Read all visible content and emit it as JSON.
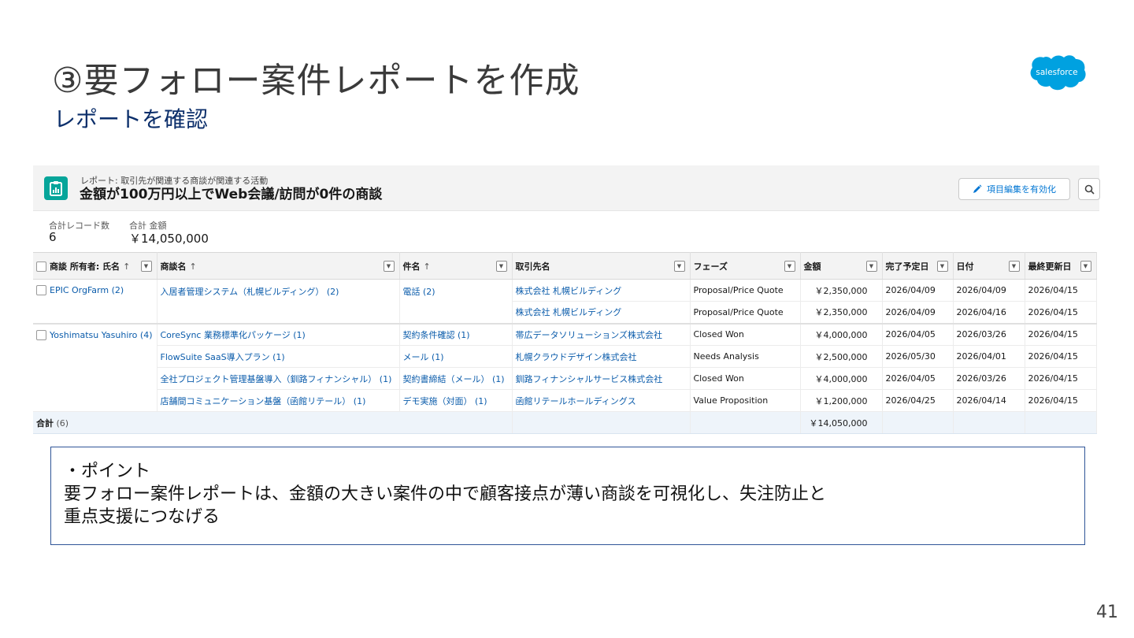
{
  "slide": {
    "title": "③要フォロー案件レポートを作成",
    "subtitle": "レポートを確認",
    "page_number": "41",
    "logo_text": "salesforce"
  },
  "report": {
    "type_label": "レポート: 取引先が関連する商談が関連する活動",
    "name": "金額が100万円以上でWeb会議/訪問が0件の商談",
    "enable_button": "項目編集を有効化",
    "summary": {
      "record_count_label": "合計レコード数",
      "record_count_value": "6",
      "total_amount_label": "合計 金額",
      "total_amount_value": "￥14,050,000"
    },
    "columns": [
      {
        "label": "商談 所有者: 氏名",
        "sort": "↑"
      },
      {
        "label": "商談名",
        "sort": "↑"
      },
      {
        "label": "件名",
        "sort": "↑"
      },
      {
        "label": "取引先名",
        "sort": ""
      },
      {
        "label": "フェーズ",
        "sort": ""
      },
      {
        "label": "金額",
        "sort": ""
      },
      {
        "label": "完了予定日",
        "sort": ""
      },
      {
        "label": "日付",
        "sort": ""
      },
      {
        "label": "最終更新日",
        "sort": ""
      }
    ],
    "rows": [
      [
        "EPIC OrgFarm (2)",
        "入居者管理システム（札幌ビルディング） (2)",
        "電話 (2)",
        "株式会社 札幌ビルディング",
        "Proposal/Price Quote",
        "￥2,350,000",
        "2026/04/09",
        "2026/04/09",
        "2026/04/15"
      ],
      [
        "",
        "",
        "",
        "株式会社 札幌ビルディング",
        "Proposal/Price Quote",
        "￥2,350,000",
        "2026/04/09",
        "2026/04/16",
        "2026/04/15"
      ],
      [
        "Yoshimatsu Yasuhiro (4)",
        "CoreSync 業務標準化パッケージ (1)",
        "契約条件確認 (1)",
        "帯広データソリューションズ株式会社",
        "Closed Won",
        "￥4,000,000",
        "2026/04/05",
        "2026/03/26",
        "2026/04/15"
      ],
      [
        "",
        "FlowSuite SaaS導入プラン (1)",
        "メール (1)",
        "札幌クラウドデザイン株式会社",
        "Needs Analysis",
        "￥2,500,000",
        "2026/05/30",
        "2026/04/01",
        "2026/04/15"
      ],
      [
        "",
        "全社プロジェクト管理基盤導入（釧路フィナンシャル） (1)",
        "契約書締結（メール） (1)",
        "釧路フィナンシャルサービス株式会社",
        "Closed Won",
        "￥4,000,000",
        "2026/04/05",
        "2026/03/26",
        "2026/04/15"
      ],
      [
        "",
        "店舗間コミュニケーション基盤（函館リテール） (1)",
        "デモ実施（対面） (1)",
        "函館リテールホールディングス",
        "Value Proposition",
        "￥1,200,000",
        "2026/04/25",
        "2026/04/14",
        "2026/04/15"
      ]
    ],
    "total_row": {
      "label": "合計",
      "count": "(6)",
      "amount": "￥14,050,000"
    }
  },
  "point": {
    "heading": "・ポイント",
    "line1": "要フォロー案件レポートは、金額の大きい案件の中で顧客接点が薄い商談を可視化し、失注防止と",
    "line2": "重点支援につなげる"
  },
  "colors": {
    "accent_blue": "#0b5cab",
    "report_icon": "#06a59a",
    "salesforce_blue": "#00a1e0",
    "point_border": "#2f5597"
  },
  "icons": {
    "report": "report-icon",
    "edit": "pencil-icon",
    "search": "search-icon",
    "dropdown": "chevron-down-icon"
  }
}
